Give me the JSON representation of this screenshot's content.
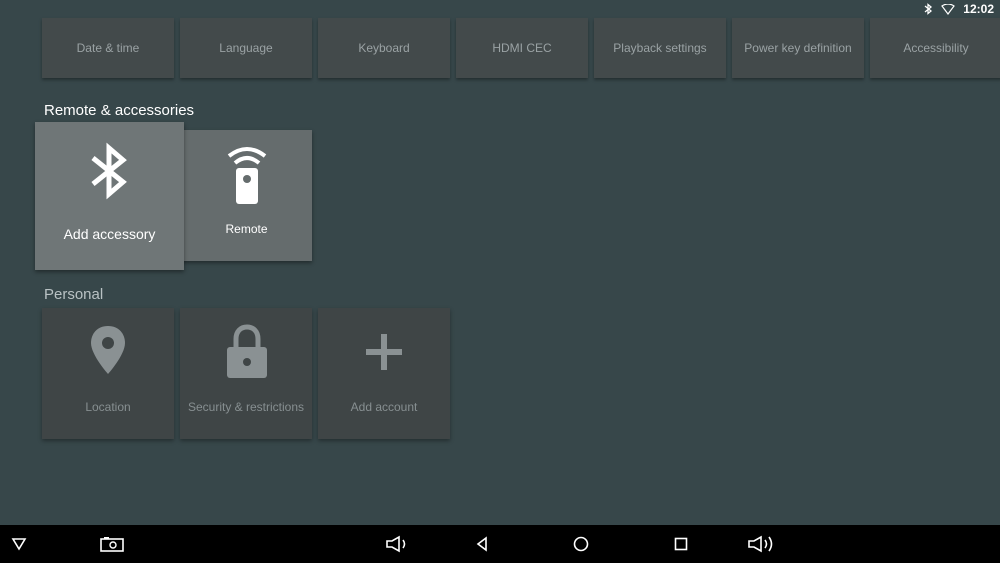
{
  "status_bar": {
    "time": "12:02",
    "icons": [
      "bluetooth-icon",
      "wifi-icon"
    ]
  },
  "top_row": {
    "tiles": [
      {
        "label": "Date & time"
      },
      {
        "label": "Language"
      },
      {
        "label": "Keyboard"
      },
      {
        "label": "HDMI CEC"
      },
      {
        "label": "Playback settings"
      },
      {
        "label": "Power key definition"
      },
      {
        "label": "Accessibility"
      }
    ]
  },
  "remote_section": {
    "title": "Remote & accessories",
    "tiles": [
      {
        "label": "Add accessory",
        "icon": "bluetooth-icon"
      },
      {
        "label": "Remote",
        "icon": "remote-icon"
      }
    ]
  },
  "personal_section": {
    "title": "Personal",
    "tiles": [
      {
        "label": "Location",
        "icon": "location-pin-icon"
      },
      {
        "label": "Security & restrictions",
        "icon": "lock-icon"
      },
      {
        "label": "Add account",
        "icon": "plus-icon"
      }
    ]
  },
  "nav_bar": {
    "buttons": [
      "hide-nav-icon",
      "screenshot-icon",
      "volume-down-icon",
      "back-icon",
      "home-icon",
      "recents-icon",
      "volume-up-icon"
    ]
  },
  "colors": {
    "background": "#37474a",
    "tile_focused": "#6f7677",
    "tile_selected": "#656c6d",
    "tile_normal": "#434a4b",
    "nav_bar": "#000000"
  }
}
